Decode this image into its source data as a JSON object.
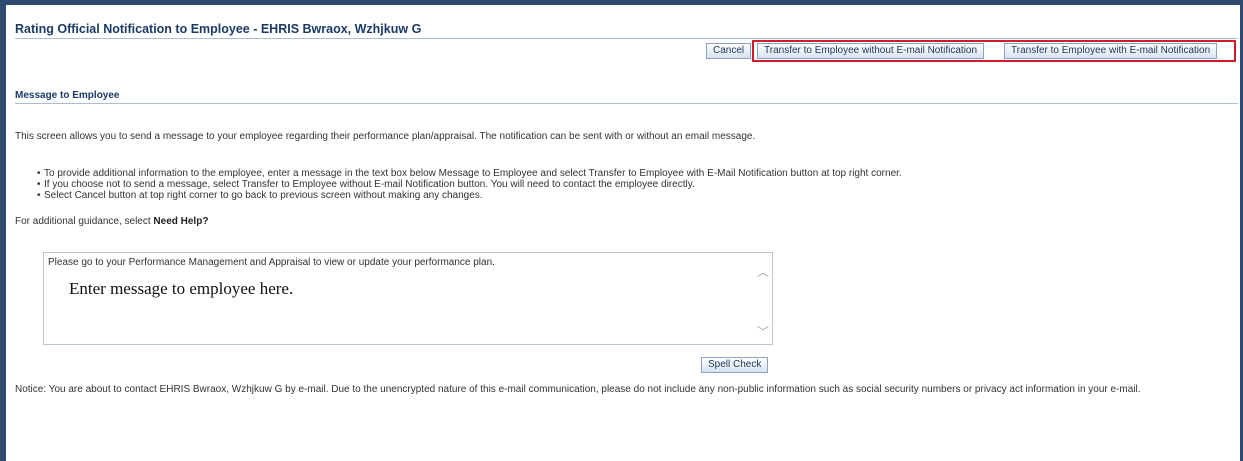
{
  "page": {
    "title": "Rating Official Notification to Employee - EHRIS Bwraox, Wzhjkuw G"
  },
  "toolbar": {
    "cancel_label": "Cancel",
    "transfer_without_label": "Transfer to Employee without E-mail Notification",
    "transfer_with_label": "Transfer to Employee with E-mail Notification"
  },
  "section": {
    "title": "Message to Employee"
  },
  "instructions": {
    "intro": "This screen allows you to send a message to your employee regarding their performance plan/appraisal. The notification can be sent with or without an email message.",
    "bullets": [
      "To provide additional information to the employee, enter a message in the text box below Message to Employee and select Transfer to Employee with E-Mail Notification button at top right corner.",
      "If you choose not to send a message, select Transfer to Employee without E-mail Notification button. You will need to contact the employee directly.",
      "Select Cancel button at top right corner to go back to previous screen without making any changes."
    ],
    "guidance_prefix": "For additional guidance, select",
    "guidance_link": "Need Help?"
  },
  "message": {
    "value": "Please go to your Performance Management and Appraisal to view or update your performance plan.",
    "overlay_hint": "Enter message to employee here."
  },
  "spell_check_label": "Spell Check",
  "notice": "Notice: You are about to contact EHRIS Bwraox, Wzhjkuw G by e-mail. Due to the unencrypted nature of this e-mail communication, please do not include any non-public information such as social security numbers or privacy act information in your e-mail.",
  "colors": {
    "frame": "#2e4a6e",
    "title": "#1c3a66",
    "highlight": "#d11a2a"
  },
  "icons": {
    "scroll_up": "chevron-up-icon",
    "scroll_down": "chevron-down-icon"
  }
}
